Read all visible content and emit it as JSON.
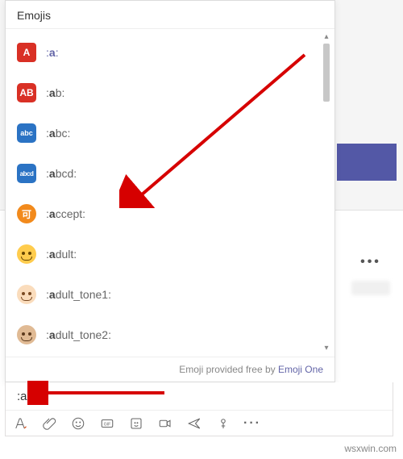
{
  "picker": {
    "title": "Emojis",
    "footer_text": "Emoji provided free by ",
    "footer_link": "Emoji One",
    "items": [
      {
        "icon_text": "A",
        "prefix": ":",
        "match": "a",
        "suffix": ":"
      },
      {
        "icon_text": "AB",
        "prefix": ":",
        "match": "a",
        "suffix": "b:"
      },
      {
        "icon_text": "abc",
        "prefix": ":",
        "match": "a",
        "suffix": "bc:"
      },
      {
        "icon_text": "abcd",
        "prefix": ":",
        "match": "a",
        "suffix": "bcd:"
      },
      {
        "icon_text": "可",
        "prefix": ":",
        "match": "a",
        "suffix": "ccept:"
      },
      {
        "icon_text": "",
        "prefix": ":",
        "match": "a",
        "suffix": "dult:"
      },
      {
        "icon_text": "",
        "prefix": ":",
        "match": "a",
        "suffix": "dult_tone1:"
      },
      {
        "icon_text": "",
        "prefix": ":",
        "match": "a",
        "suffix": "dult_tone2:"
      }
    ]
  },
  "compose": {
    "value": ":a"
  },
  "bgmore": "•••",
  "watermark": "wsxwin.com"
}
